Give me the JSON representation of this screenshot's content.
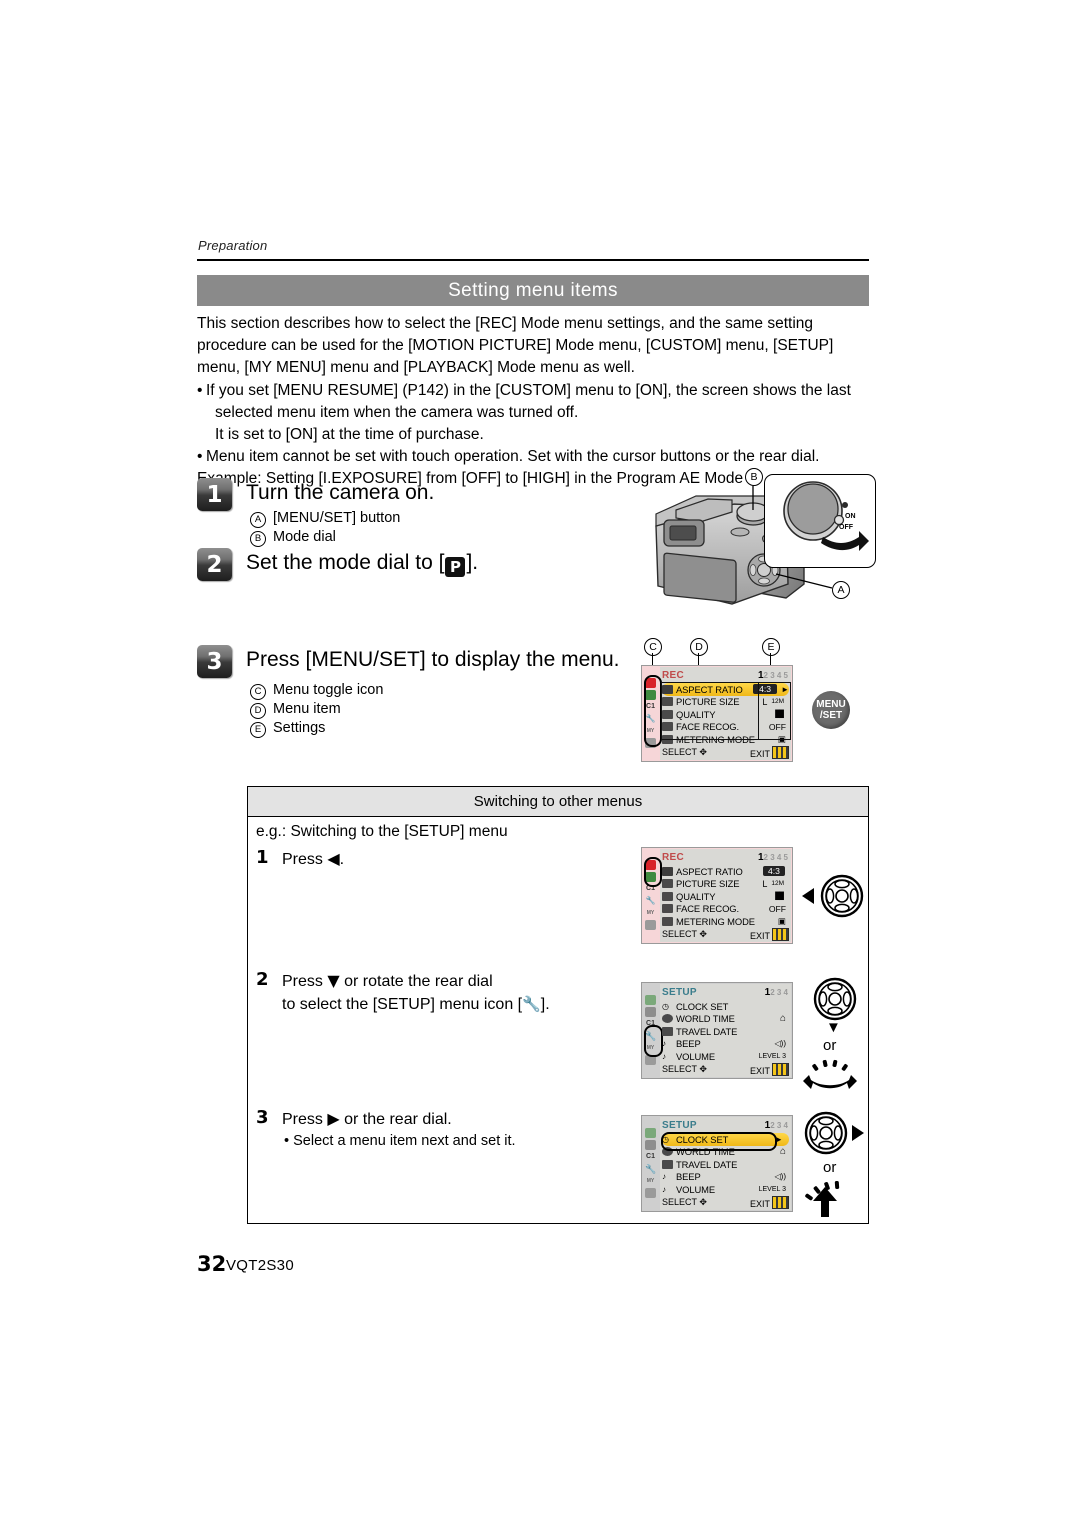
{
  "document": {
    "running_head": "Preparation",
    "page_number": "32",
    "doc_code": "VQT2S30"
  },
  "section": {
    "title": "Setting menu items",
    "intro_paragraph": "This section describes how to select the [REC] Mode menu settings, and the same setting procedure can be used for the [MOTION PICTURE] Mode menu, [CUSTOM] menu, [SETUP] menu, [MY MENU] menu and [PLAYBACK] Mode menu as well.",
    "bullets": [
      {
        "line1": "If you set [MENU RESUME] (P142) in the [CUSTOM] menu to [ON], the screen shows the last",
        "line2": "selected menu item when the camera was turned off.",
        "line3": "It is set to [ON] at the time of purchase."
      },
      {
        "line1": "Menu item cannot be set with touch operation. Set with the cursor buttons or the rear dial."
      }
    ],
    "example_line": "Example: Setting [I.EXPOSURE] from [OFF] to [HIGH] in the Program AE Mode"
  },
  "steps": [
    {
      "number": "1",
      "title": "Turn the camera on.",
      "sub": [
        {
          "letter": "A",
          "text": "[MENU/SET] button"
        },
        {
          "letter": "B",
          "text": "Mode dial"
        }
      ]
    },
    {
      "number": "2",
      "title_before": "Set the mode dial to [",
      "badge": "P",
      "title_after": "]."
    },
    {
      "number": "3",
      "title": "Press [MENU/SET] to display the menu.",
      "sub": [
        {
          "letter": "C",
          "text": "Menu toggle icon"
        },
        {
          "letter": "D",
          "text": "Menu item"
        },
        {
          "letter": "E",
          "text": "Settings"
        }
      ]
    }
  ],
  "camera_art": {
    "callout_a": "A",
    "callout_b": "B",
    "power_on": "ON",
    "power_off": "OFF"
  },
  "menu_button": {
    "line1": "MENU",
    "line2": "/SET"
  },
  "rec_menu": {
    "callouts": {
      "c": "C",
      "d": "D",
      "e": "E"
    },
    "header": "REC",
    "page_current": "1",
    "page_rest": "2 3 4 5",
    "rows": [
      {
        "label": "ASPECT RATIO",
        "value": "4:3",
        "selected": true
      },
      {
        "label": "PICTURE SIZE",
        "value": "L",
        "value2": "12M"
      },
      {
        "label": "QUALITY",
        "value": "██"
      },
      {
        "label": "FACE RECOG.",
        "value": "OFF"
      },
      {
        "label": "METERING MODE",
        "value": "▣"
      }
    ],
    "footer_left": "SELECT",
    "footer_right": "EXIT"
  },
  "boxed_section": {
    "header": "Switching to other menus",
    "eg_line": "e.g.: Switching to the [SETUP] menu",
    "steps": [
      {
        "number": "1",
        "text_before": "Press ",
        "arrow": "◀",
        "text_after": "."
      },
      {
        "number": "2",
        "line1_before": "Press ",
        "line1_arrow": "▼",
        "line1_after": " or rotate the rear dial",
        "line2_before": "to select the [SETUP] menu icon [",
        "line2_icon": "wrench-icon",
        "line2_after": "]."
      },
      {
        "number": "3",
        "text_before": "Press ",
        "arrow": "▶",
        "text_after": " or the rear dial.",
        "note": "Select a menu item next and set it."
      }
    ],
    "or_label": "or",
    "screens": [
      {
        "id": "rec-after-left",
        "header": "REC",
        "page_current": "1",
        "page_rest": "2 3 4 5",
        "rows": [
          {
            "label": "ASPECT RATIO",
            "value": "4:3"
          },
          {
            "label": "PICTURE SIZE",
            "value": "L",
            "value2": "12M"
          },
          {
            "label": "QUALITY",
            "value": "██"
          },
          {
            "label": "FACE RECOG.",
            "value": "OFF"
          },
          {
            "label": "METERING MODE",
            "value": "▣"
          }
        ],
        "footer_left": "SELECT",
        "footer_right": "EXIT"
      },
      {
        "id": "setup-selected",
        "header": "SETUP",
        "page_current": "1",
        "page_rest": "2 3 4",
        "rows": [
          {
            "label": "CLOCK SET",
            "value": ""
          },
          {
            "label": "WORLD TIME",
            "value": "⌂"
          },
          {
            "label": "TRAVEL DATE",
            "value": ""
          },
          {
            "label": "BEEP",
            "value": "◁))"
          },
          {
            "label": "VOLUME",
            "value": "LEVEL 3"
          }
        ],
        "footer_left": "SELECT",
        "footer_right": "EXIT"
      },
      {
        "id": "setup-clockset-highlighted",
        "header": "SETUP",
        "page_current": "1",
        "page_rest": "2 3 4",
        "rows": [
          {
            "label": "CLOCK SET",
            "value": "",
            "selected": true
          },
          {
            "label": "WORLD TIME",
            "value": "⌂"
          },
          {
            "label": "TRAVEL DATE",
            "value": ""
          },
          {
            "label": "BEEP",
            "value": "◁))"
          },
          {
            "label": "VOLUME",
            "value": "LEVEL 3"
          }
        ],
        "footer_left": "SELECT",
        "footer_right": "EXIT"
      }
    ]
  },
  "colors": {
    "title_bar": "#8a8a8a",
    "box_header": "#e3e3e3",
    "lcd_body": "#d9d9d5",
    "lcd_rail_rec": "#f6d6d8",
    "highlight_yellow": "#f0b818",
    "rec_icon_red": "#d8232a",
    "setup_icon_yellow": "#f2b01a"
  }
}
